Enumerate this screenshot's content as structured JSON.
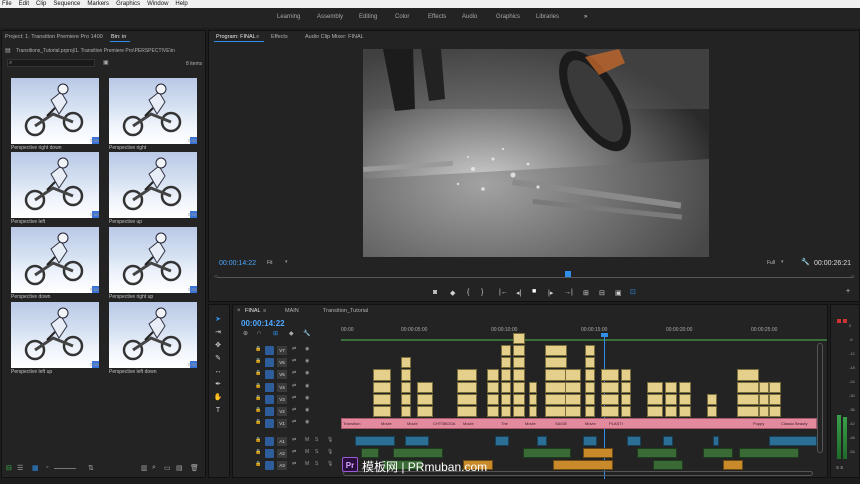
{
  "menu": [
    "File",
    "Edit",
    "Clip",
    "Sequence",
    "Markers",
    "Graphics",
    "Window",
    "Help"
  ],
  "workspaces": [
    "Learning",
    "Assembly",
    "Editing",
    "Color",
    "Effects",
    "Audio",
    "Graphics",
    "Libraries"
  ],
  "workspace_more": "»",
  "project": {
    "tab_project": "Project: 1. Transition Premiere Pro 1400",
    "tab_bin": "Bin: in",
    "path": "Transitions_Tutorial.prproj\\1. Transition Premiere Pro\\PERSPECTIVE\\in",
    "item_count": "8 items",
    "items": [
      {
        "label": "Perspective  right down",
        "dur": "0:16"
      },
      {
        "label": "Perspective  right",
        "dur": "0:16"
      },
      {
        "label": "Perspective  left",
        "dur": "0:16"
      },
      {
        "label": "Perspective  up",
        "dur": "0:16"
      },
      {
        "label": "Perspective  down",
        "dur": "0:16"
      },
      {
        "label": "Perspective  right up",
        "dur": "0:16"
      },
      {
        "label": "Perspective  left up",
        "dur": "0:16"
      },
      {
        "label": "Perspective  left down",
        "dur": "0:16"
      }
    ]
  },
  "program": {
    "tab_program": "Program: FINAL",
    "tab_effects": "Effects",
    "tab_mixer": "Audio Clip Mixer: FINAL",
    "timecode": "00:00:14:22",
    "fit": "Fit",
    "quality": "Full",
    "duration": "00:00:26:21"
  },
  "timeline": {
    "tab_final": "FINAL",
    "tab_main": "MAIN",
    "tab_tutorial": "Transition_Tutorial",
    "timecode": "00:00:14:22",
    "ruler": [
      "00:00",
      "00:00:05:00",
      "00:00:10:00",
      "00:00:15:00",
      "00:00:20:00",
      "00:00:25:00"
    ],
    "video_tracks": [
      "V7",
      "V6",
      "V5",
      "V4",
      "V3",
      "V2",
      "V1"
    ],
    "audio_tracks": [
      "A1",
      "A2",
      "A3"
    ],
    "v1_clips": [
      "Transition",
      "Movie",
      "Movie",
      "CHTSBOOA",
      "Movie",
      "The",
      "Movie",
      "SAIGE",
      "Movie",
      "PLASTI",
      "Puppy",
      "Classic Beauty"
    ],
    "adjust_label": "Adjust",
    "meter_scale": [
      "0",
      "-6",
      "-12",
      "-18",
      "-24",
      "-30",
      "-36",
      "-42",
      "-48",
      "-54"
    ],
    "meter_ss": "S  S"
  },
  "watermark": {
    "badge": "Pr",
    "text": "模板网 | PRmuban.com"
  },
  "colors": {
    "accent_blue": "#2f8fe8",
    "video_clip": "#e4d08a",
    "pink_clip": "#e48a9f",
    "audio_clip": "#2c6f94"
  }
}
